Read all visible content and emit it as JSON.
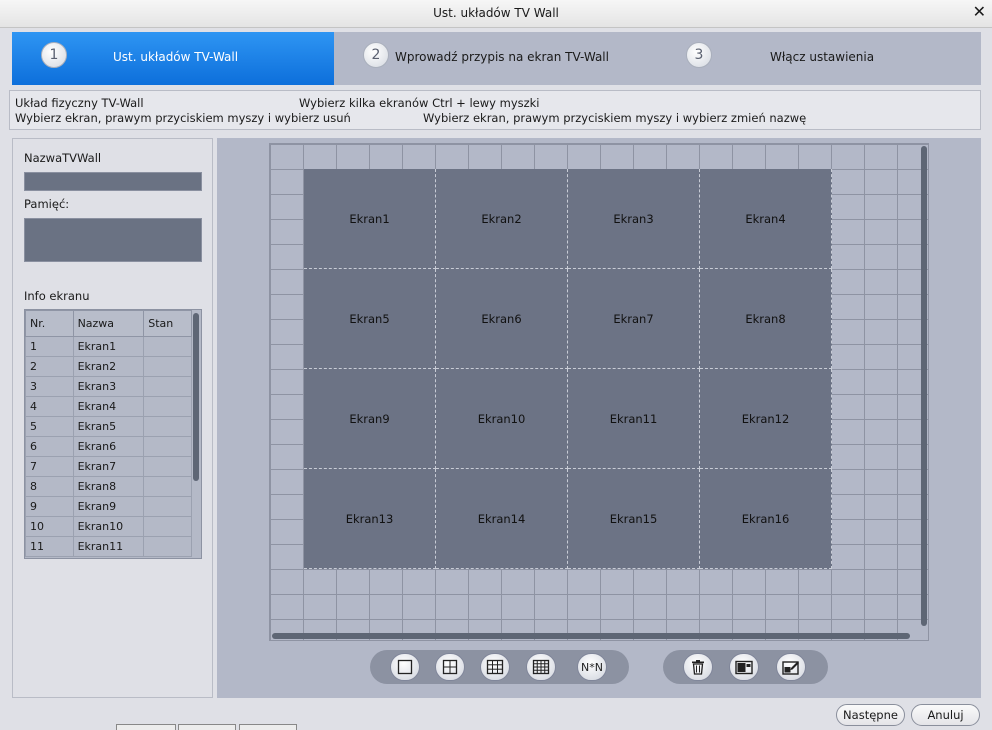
{
  "window": {
    "title": "Ust. układów TV Wall",
    "close_glyph": "✕"
  },
  "steps": [
    {
      "num": "1",
      "label": "Ust. układów TV-Wall"
    },
    {
      "num": "2",
      "label": "Wprowadź przypis na ekran TV-Wall"
    },
    {
      "num": "3",
      "label": "Włącz ustawienia"
    }
  ],
  "hints": {
    "layout": "Układ fizyczny TV-Wall",
    "select_multi": "Wybierz kilka ekranów Ctrl + lewy myszki",
    "delete": "Wybierz ekran, prawym przyciskiem myszy i wybierz usuń",
    "rename": "Wybierz ekran, prawym przyciskiem myszy i wybierz zmień nazwę"
  },
  "left": {
    "name_label": "NazwaTVWall",
    "name_value": "",
    "memory_label": "Pamięć:",
    "memory_value": "",
    "info_label": "Info ekranu",
    "columns": [
      "Nr.",
      "Nazwa",
      "Stan"
    ],
    "rows": [
      [
        "1",
        "Ekran1",
        ""
      ],
      [
        "2",
        "Ekran2",
        ""
      ],
      [
        "3",
        "Ekran3",
        ""
      ],
      [
        "4",
        "Ekran4",
        ""
      ],
      [
        "5",
        "Ekran5",
        ""
      ],
      [
        "6",
        "Ekran6",
        ""
      ],
      [
        "7",
        "Ekran7",
        ""
      ],
      [
        "8",
        "Ekran8",
        ""
      ],
      [
        "9",
        "Ekran9",
        ""
      ],
      [
        "10",
        "Ekran10",
        ""
      ],
      [
        "11",
        "Ekran11",
        ""
      ]
    ]
  },
  "screens": [
    "Ekran1",
    "Ekran2",
    "Ekran3",
    "Ekran4",
    "Ekran5",
    "Ekran6",
    "Ekran7",
    "Ekran8",
    "Ekran9",
    "Ekran10",
    "Ekran11",
    "Ekran12",
    "Ekran13",
    "Ekran14",
    "Ekran15",
    "Ekran16"
  ],
  "toolbar": {
    "layouts": [
      {
        "name": "layout-1x1-icon"
      },
      {
        "name": "layout-2x2-icon"
      },
      {
        "name": "layout-3x3-icon"
      },
      {
        "name": "layout-4x4-icon"
      },
      {
        "name": "layout-nxn-button",
        "label": "N*N"
      }
    ],
    "actions": [
      {
        "name": "trash-icon"
      },
      {
        "name": "screen-window-icon"
      },
      {
        "name": "screen-edit-icon"
      }
    ]
  },
  "buttons": {
    "next": "Następne",
    "cancel": "Anuluj"
  }
}
